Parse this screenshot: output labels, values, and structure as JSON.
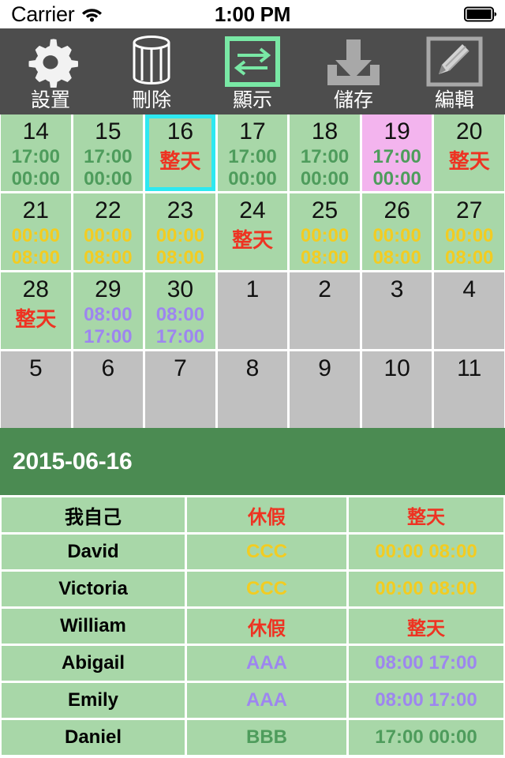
{
  "status_bar": {
    "carrier": "Carrier",
    "wifi_icon": "wifi-icon",
    "time": "1:00 PM",
    "battery_icon": "battery-full-icon"
  },
  "toolbar": {
    "background": "#4d4d4d",
    "items": [
      {
        "label": "設置",
        "icon": "gear-icon",
        "active": false
      },
      {
        "label": "刪除",
        "icon": "trash-icon",
        "active": false
      },
      {
        "label": "顯示",
        "icon": "swap-arrows-icon",
        "active": true
      },
      {
        "label": "儲存",
        "icon": "download-icon",
        "active": false
      },
      {
        "label": "編輯",
        "icon": "pencil-edit-icon",
        "active": false
      }
    ]
  },
  "colors": {
    "green_cell": "#a8d7a8",
    "grey_cell": "#c0c0c0",
    "pink_cell": "#f3b4ee",
    "selection_outline": "#2ee8f0",
    "header_green": "#4b8b52",
    "text_green": "#4e9c5c",
    "text_yellow": "#f2cc22",
    "text_purple": "#9d86ef",
    "text_red": "#ee3322",
    "toolbar_active_green": "#79e8a5"
  },
  "calendar": {
    "cells": [
      {
        "day": "14",
        "state": "green",
        "selected": false,
        "line1": "17:00",
        "line2": "00:00",
        "line_color": "c-green"
      },
      {
        "day": "15",
        "state": "green",
        "selected": false,
        "line1": "17:00",
        "line2": "00:00",
        "line_color": "c-green"
      },
      {
        "day": "16",
        "state": "green",
        "selected": true,
        "allday": "整天"
      },
      {
        "day": "17",
        "state": "green",
        "selected": false,
        "line1": "17:00",
        "line2": "00:00",
        "line_color": "c-green"
      },
      {
        "day": "18",
        "state": "green",
        "selected": false,
        "line1": "17:00",
        "line2": "00:00",
        "line_color": "c-green"
      },
      {
        "day": "19",
        "state": "pink",
        "selected": false,
        "line1": "17:00",
        "line2": "00:00",
        "line_color": "c-green"
      },
      {
        "day": "20",
        "state": "green",
        "selected": false,
        "allday": "整天"
      },
      {
        "day": "21",
        "state": "green",
        "selected": false,
        "line1": "00:00",
        "line2": "08:00",
        "line_color": "c-yellow"
      },
      {
        "day": "22",
        "state": "green",
        "selected": false,
        "line1": "00:00",
        "line2": "08:00",
        "line_color": "c-yellow"
      },
      {
        "day": "23",
        "state": "green",
        "selected": false,
        "line1": "00:00",
        "line2": "08:00",
        "line_color": "c-yellow"
      },
      {
        "day": "24",
        "state": "green",
        "selected": false,
        "allday": "整天"
      },
      {
        "day": "25",
        "state": "green",
        "selected": false,
        "line1": "00:00",
        "line2": "08:00",
        "line_color": "c-yellow"
      },
      {
        "day": "26",
        "state": "green",
        "selected": false,
        "line1": "00:00",
        "line2": "08:00",
        "line_color": "c-yellow"
      },
      {
        "day": "27",
        "state": "green",
        "selected": false,
        "line1": "00:00",
        "line2": "08:00",
        "line_color": "c-yellow"
      },
      {
        "day": "28",
        "state": "green",
        "selected": false,
        "allday": "整天"
      },
      {
        "day": "29",
        "state": "green",
        "selected": false,
        "line1": "08:00",
        "line2": "17:00",
        "line_color": "c-purple"
      },
      {
        "day": "30",
        "state": "green",
        "selected": false,
        "line1": "08:00",
        "line2": "17:00",
        "line_color": "c-purple"
      },
      {
        "day": "1",
        "state": "grey",
        "selected": false
      },
      {
        "day": "2",
        "state": "grey",
        "selected": false
      },
      {
        "day": "3",
        "state": "grey",
        "selected": false
      },
      {
        "day": "4",
        "state": "grey",
        "selected": false
      },
      {
        "day": "5",
        "state": "grey",
        "selected": false
      },
      {
        "day": "6",
        "state": "grey",
        "selected": false
      },
      {
        "day": "7",
        "state": "grey",
        "selected": false
      },
      {
        "day": "8",
        "state": "grey",
        "selected": false
      },
      {
        "day": "9",
        "state": "grey",
        "selected": false
      },
      {
        "day": "10",
        "state": "grey",
        "selected": false
      },
      {
        "day": "11",
        "state": "grey",
        "selected": false
      }
    ]
  },
  "date_header": {
    "date": "2015-06-16"
  },
  "people_table": {
    "rows": [
      {
        "name": "我自己",
        "note": "休假",
        "note_color": "c-red",
        "time": "整天",
        "time_color": "c-red"
      },
      {
        "name": "David",
        "note": "CCC",
        "note_color": "c-yellow",
        "time": "00:00 08:00",
        "time_color": "c-yellow"
      },
      {
        "name": "Victoria",
        "note": "CCC",
        "note_color": "c-yellow",
        "time": "00:00 08:00",
        "time_color": "c-yellow"
      },
      {
        "name": "William",
        "note": "休假",
        "note_color": "c-red",
        "time": "整天",
        "time_color": "c-red"
      },
      {
        "name": "Abigail",
        "note": "AAA",
        "note_color": "c-purple",
        "time": "08:00 17:00",
        "time_color": "c-purple"
      },
      {
        "name": "Emily",
        "note": "AAA",
        "note_color": "c-purple",
        "time": "08:00 17:00",
        "time_color": "c-purple"
      },
      {
        "name": "Daniel",
        "note": "BBB",
        "note_color": "c-green",
        "time": "17:00 00:00",
        "time_color": "c-green"
      }
    ]
  }
}
